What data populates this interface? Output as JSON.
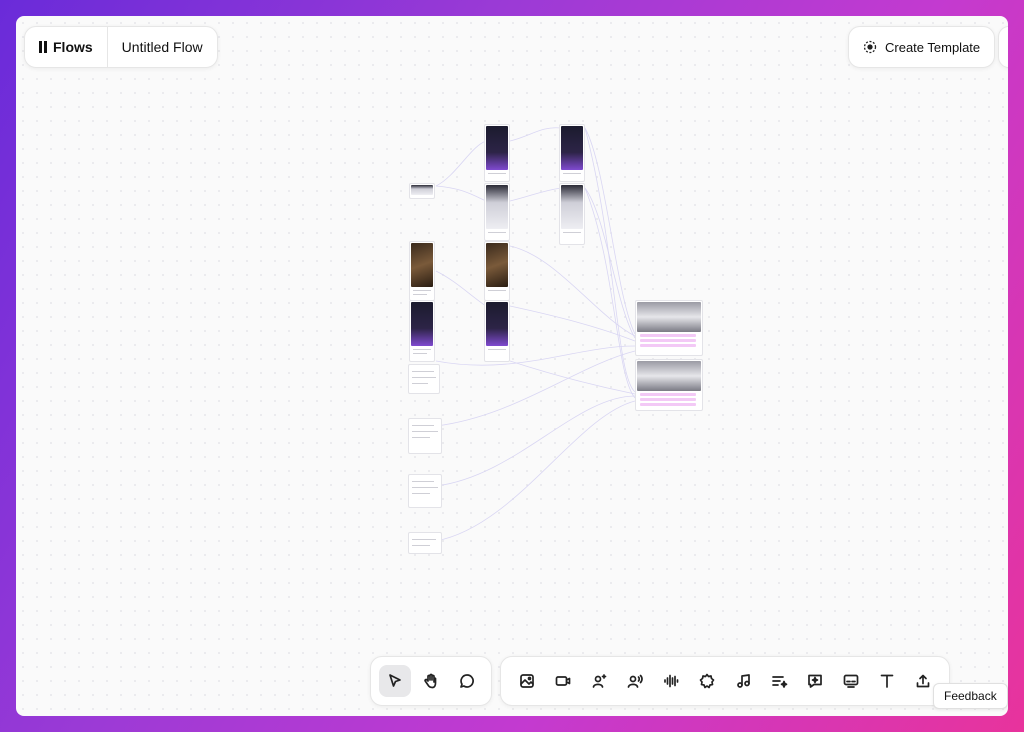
{
  "app": {
    "name": "Flows",
    "flow_title": "Untitled Flow"
  },
  "header": {
    "create_template_label": "Create Template"
  },
  "toolbar": {
    "left_tools": [
      {
        "name": "select-tool",
        "icon": "cursor-arrow-icon",
        "active": true
      },
      {
        "name": "pan-tool",
        "icon": "hand-icon",
        "active": false
      },
      {
        "name": "comment-tool",
        "icon": "speech-bubble-icon",
        "active": false
      }
    ],
    "right_tools": [
      {
        "name": "image-node",
        "icon": "image-icon"
      },
      {
        "name": "video-node",
        "icon": "video-camera-icon"
      },
      {
        "name": "character-node",
        "icon": "person-sparkle-icon"
      },
      {
        "name": "voice-node",
        "icon": "person-voice-icon"
      },
      {
        "name": "audio-node",
        "icon": "waveform-icon"
      },
      {
        "name": "effect-node",
        "icon": "gear-burst-icon"
      },
      {
        "name": "music-node",
        "icon": "music-note-icon"
      },
      {
        "name": "prompt-node",
        "icon": "list-sparkle-icon"
      },
      {
        "name": "chat-node",
        "icon": "chat-sparkle-icon"
      },
      {
        "name": "caption-node",
        "icon": "caption-screen-icon"
      },
      {
        "name": "text-node",
        "icon": "text-t-icon"
      },
      {
        "name": "upload-node",
        "icon": "upload-icon"
      }
    ]
  },
  "feedback_label": "Feedback",
  "colors": {
    "accent": "#8b7cf6",
    "background_start": "#6a2bd9",
    "background_end": "#e8339c",
    "canvas": "#fafafa",
    "node_highlight": "#f3c9f6"
  }
}
